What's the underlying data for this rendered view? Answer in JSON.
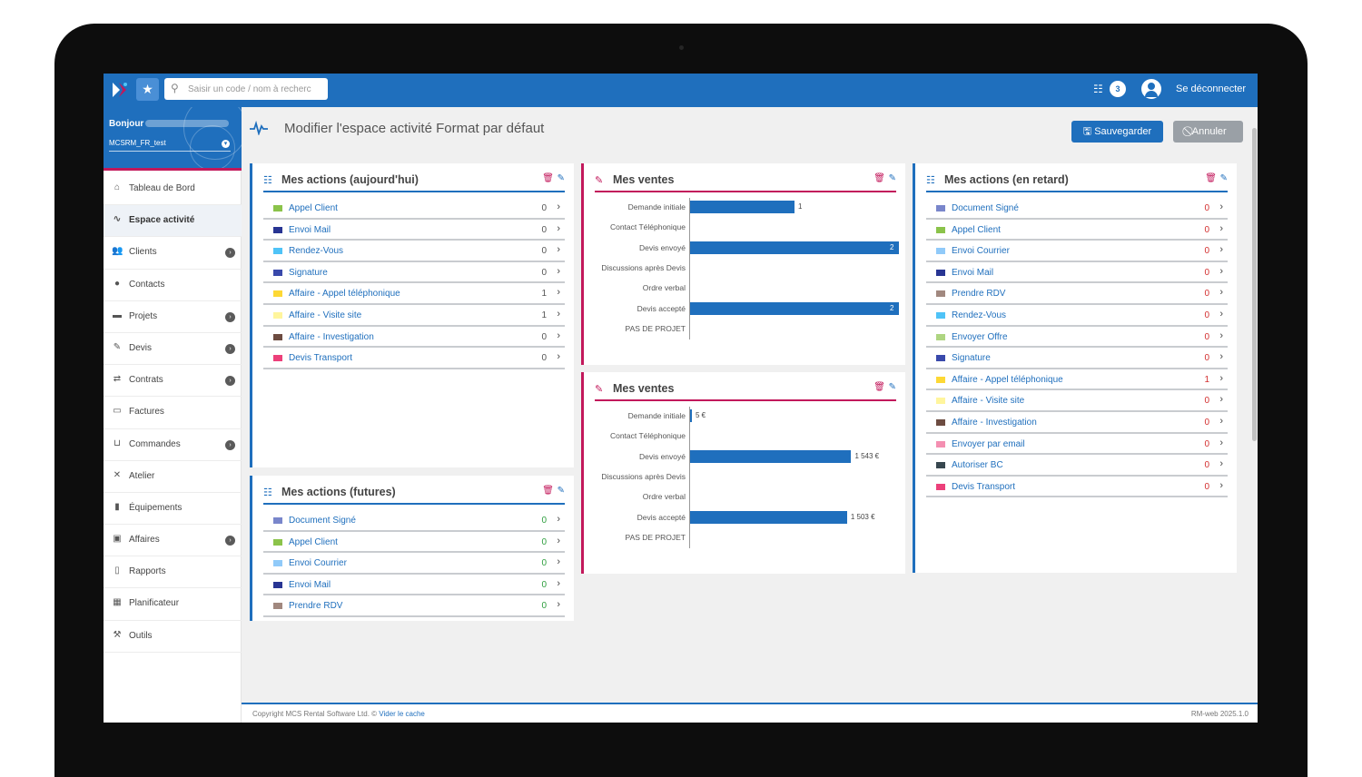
{
  "topbar": {
    "search_placeholder": "Saisir un code / nom à recherc",
    "notification_count": "3",
    "logout_label": "Se déconnecter"
  },
  "sidebar": {
    "greeting": "Bonjour",
    "account": "MCSRM_FR_test",
    "items": [
      {
        "label": "Tableau de Bord",
        "icon": "home-icon",
        "has_submenu": false
      },
      {
        "label": "Espace activité",
        "icon": "pulse-icon",
        "has_submenu": false,
        "active": true
      },
      {
        "label": "Clients",
        "icon": "users-icon",
        "has_submenu": true
      },
      {
        "label": "Contacts",
        "icon": "user-icon",
        "has_submenu": false
      },
      {
        "label": "Projets",
        "icon": "folder-icon",
        "has_submenu": true
      },
      {
        "label": "Devis",
        "icon": "edit-icon",
        "has_submenu": true
      },
      {
        "label": "Contrats",
        "icon": "handshake-icon",
        "has_submenu": true
      },
      {
        "label": "Factures",
        "icon": "invoice-icon",
        "has_submenu": false
      },
      {
        "label": "Commandes",
        "icon": "cart-icon",
        "has_submenu": true
      },
      {
        "label": "Atelier",
        "icon": "tools-icon",
        "has_submenu": false
      },
      {
        "label": "Équipements",
        "icon": "barcode-icon",
        "has_submenu": false
      },
      {
        "label": "Affaires",
        "icon": "briefcase-icon",
        "has_submenu": true
      },
      {
        "label": "Rapports",
        "icon": "file-icon",
        "has_submenu": false
      },
      {
        "label": "Planificateur",
        "icon": "calendar-icon",
        "has_submenu": false
      },
      {
        "label": "Outils",
        "icon": "wrench-icon",
        "has_submenu": false
      }
    ]
  },
  "page": {
    "title": "Modifier l'espace activité Format par défaut",
    "save_label": "Sauvegarder",
    "cancel_label": "Annuler"
  },
  "panels": {
    "today": {
      "title": "Mes actions (aujourd'hui)",
      "rows": [
        {
          "label": "Appel Client",
          "value": "0",
          "swatch": "#8bc34a"
        },
        {
          "label": "Envoi Mail",
          "value": "0",
          "swatch": "#283593"
        },
        {
          "label": "Rendez-Vous",
          "value": "0",
          "swatch": "#4fc3f7"
        },
        {
          "label": "Signature",
          "value": "0",
          "swatch": "#3949ab"
        },
        {
          "label": "Affaire - Appel téléphonique",
          "value": "1",
          "swatch": "#fdd835"
        },
        {
          "label": "Affaire - Visite site",
          "value": "1",
          "swatch": "#fff59d"
        },
        {
          "label": "Affaire - Investigation",
          "value": "0",
          "swatch": "#6d4c41"
        },
        {
          "label": "Devis Transport",
          "value": "0",
          "swatch": "#ec407a"
        }
      ]
    },
    "future": {
      "title": "Mes actions (futures)",
      "rows": [
        {
          "label": "Document Signé",
          "value": "0",
          "swatch": "#7986cb"
        },
        {
          "label": "Appel Client",
          "value": "0",
          "swatch": "#8bc34a"
        },
        {
          "label": "Envoi Courrier",
          "value": "0",
          "swatch": "#90caf9"
        },
        {
          "label": "Envoi Mail",
          "value": "0",
          "swatch": "#283593"
        },
        {
          "label": "Prendre RDV",
          "value": "0",
          "swatch": "#a1887f"
        }
      ]
    },
    "late": {
      "title": "Mes actions (en retard)",
      "rows": [
        {
          "label": "Document Signé",
          "value": "0",
          "swatch": "#7986cb"
        },
        {
          "label": "Appel Client",
          "value": "0",
          "swatch": "#8bc34a"
        },
        {
          "label": "Envoi Courrier",
          "value": "0",
          "swatch": "#90caf9"
        },
        {
          "label": "Envoi Mail",
          "value": "0",
          "swatch": "#283593"
        },
        {
          "label": "Prendre RDV",
          "value": "0",
          "swatch": "#a1887f"
        },
        {
          "label": "Rendez-Vous",
          "value": "0",
          "swatch": "#4fc3f7"
        },
        {
          "label": "Envoyer Offre",
          "value": "0",
          "swatch": "#aed581"
        },
        {
          "label": "Signature",
          "value": "0",
          "swatch": "#3949ab"
        },
        {
          "label": "Affaire - Appel téléphonique",
          "value": "1",
          "swatch": "#fdd835"
        },
        {
          "label": "Affaire - Visite site",
          "value": "0",
          "swatch": "#fff59d"
        },
        {
          "label": "Affaire - Investigation",
          "value": "0",
          "swatch": "#6d4c41"
        },
        {
          "label": "Envoyer par email",
          "value": "0",
          "swatch": "#f48fb1"
        },
        {
          "label": "Autoriser BC",
          "value": "0",
          "swatch": "#37474f"
        },
        {
          "label": "Devis Transport",
          "value": "0",
          "swatch": "#ec407a"
        }
      ]
    },
    "sales1": {
      "title": "Mes ventes"
    },
    "sales2": {
      "title": "Mes ventes"
    }
  },
  "chart_data": [
    {
      "type": "bar",
      "orientation": "horizontal",
      "title": "Mes ventes",
      "categories": [
        "Demande initiale",
        "Contact Téléphonique",
        "Devis envoyé",
        "Discussions après Devis",
        "Ordre verbal",
        "Devis accepté",
        "PAS DE PROJET"
      ],
      "values": [
        1,
        0,
        2,
        0,
        0,
        2,
        0
      ],
      "value_labels": [
        "1",
        "",
        "2",
        "",
        "",
        "2",
        ""
      ],
      "xlim": [
        0,
        2
      ],
      "color": "#1f6fbd"
    },
    {
      "type": "bar",
      "orientation": "horizontal",
      "title": "Mes ventes",
      "categories": [
        "Demande initiale",
        "Contact Téléphonique",
        "Devis envoyé",
        "Discussions après Devis",
        "Ordre verbal",
        "Devis accepté",
        "PAS DE PROJET"
      ],
      "values": [
        5,
        0,
        1543,
        0,
        0,
        1503,
        0
      ],
      "value_labels": [
        "5 €",
        "",
        "1 543 €",
        "",
        "",
        "1 503 €",
        ""
      ],
      "xlim": [
        0,
        2000
      ],
      "color": "#1f6fbd"
    }
  ],
  "footer": {
    "copyright": "Copyright MCS Rental Software Ltd. ©",
    "clear_cache": "Vider le cache",
    "version": "RM-web 2025.1.0"
  }
}
